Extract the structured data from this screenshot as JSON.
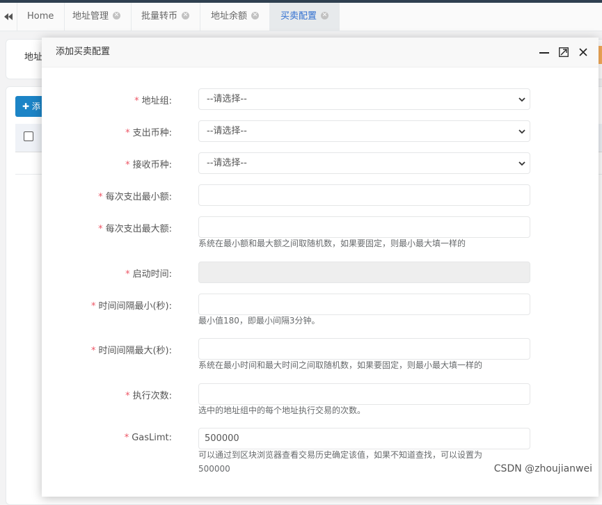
{
  "tabs": {
    "home": "Home",
    "items": [
      "地址管理",
      "批量转币",
      "地址余额",
      "买卖配置"
    ]
  },
  "background": {
    "filter_label_partial": "地址",
    "add_button_partial": "添"
  },
  "modal": {
    "title": "添加买卖配置"
  },
  "form": {
    "address_group": {
      "label": "地址组:",
      "value": "--请选择--"
    },
    "pay_currency": {
      "label": "支出币种:",
      "value": "--请选择--"
    },
    "receive_currency": {
      "label": "接收币种:",
      "value": "--请选择--"
    },
    "min_amount": {
      "label": "每次支出最小额:",
      "value": ""
    },
    "max_amount": {
      "label": "每次支出最大额:",
      "value": "",
      "help": "系统在最小额和最大额之间取随机数，如果要固定，则最小最大填一样的"
    },
    "start_time": {
      "label": "启动时间:",
      "value": ""
    },
    "interval_min": {
      "label": "时间间隔最小(秒):",
      "value": "",
      "help": "最小值180，即最小间隔3分钟。"
    },
    "interval_max": {
      "label": "时间间隔最大(秒):",
      "value": "",
      "help": "系统在最小时间和最大时间之间取随机数，如果要固定，则最小最大填一样的"
    },
    "exec_count": {
      "label": "执行次数:",
      "value": "",
      "help": "选中的地址组中的每个地址执行交易的次数。"
    },
    "gas_limit": {
      "label": "GasLimt:",
      "value": "500000",
      "help": "可以通过到区块浏览器查看交易历史确定该值，如果不知道查找，可以设置为500000"
    }
  },
  "watermark": "CSDN @zhoujianwei",
  "colors": {
    "required": "#ed5565",
    "active_tab_text": "#2f6ed0",
    "primary_button": "#1c84c6"
  }
}
